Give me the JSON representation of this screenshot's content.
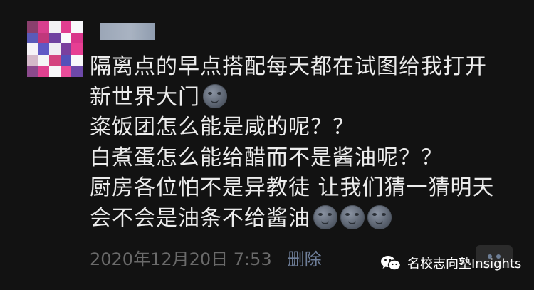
{
  "post": {
    "content_lines": [
      "隔离点的早点搭配每天都在试图给我打开",
      "新世界大门",
      "粢饭团怎么能是咸的呢？？",
      "白煮蛋怎么能给醋而不是酱油呢？？",
      "厨房各位怕不是异教徒 让我们猜一猜明天",
      "会不会是油条不给酱油"
    ],
    "timestamp": "2020年12月20日 7:53",
    "delete_label": "删除"
  },
  "emoji": {
    "name": "new-moon-face",
    "count_line2": 1,
    "count_line6": 3
  },
  "watermark": {
    "text": "名校志向塾Insights",
    "icon": "wechat-icon"
  },
  "colors": {
    "background": "#121212",
    "text": "#ececec",
    "timestamp": "#6a6a6a",
    "link": "#6f7f9a",
    "more_button_bg": "#2b2b2b"
  }
}
